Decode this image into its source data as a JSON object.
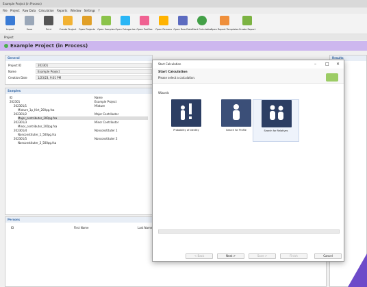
{
  "app": {
    "title": "Example Project (in Process)"
  },
  "menu": [
    "File",
    "Project",
    "Raw Data",
    "Calculation",
    "Reports",
    "Window",
    "Settings",
    "?"
  ],
  "toolbar": [
    {
      "label": "Import",
      "color": "#3a7bd5"
    },
    {
      "label": "Save",
      "color": "#9aa7b8"
    },
    {
      "label": "Print",
      "color": "#555555"
    },
    {
      "label": "Create Project",
      "color": "#f2b233"
    },
    {
      "label": "Open Projects",
      "color": "#e1a028"
    },
    {
      "label": "Open Samples",
      "color": "#8bc34a"
    },
    {
      "label": "Open Categories",
      "color": "#29b6f6"
    },
    {
      "label": "Open Profiles",
      "color": "#f06292"
    },
    {
      "label": "Open Persons",
      "color": "#ffb300"
    },
    {
      "label": "Open Raw Data",
      "color": "#5c6bc0"
    },
    {
      "label": "Start Calculation",
      "color": "#43a047"
    },
    {
      "label": "Open Report Templates",
      "color": "#ef8f3b"
    },
    {
      "label": "Create Report",
      "color": "#7cb342"
    }
  ],
  "tab": "Project",
  "project": {
    "header": "Example Project (in Process)",
    "general": {
      "title": "General",
      "fields": [
        {
          "label": "Project ID",
          "value": "202301"
        },
        {
          "label": "Name",
          "value": "Example Project"
        },
        {
          "label": "Creation Date",
          "value": "1/23/23, 9:01 PM"
        }
      ]
    },
    "samples": {
      "title": "Samples",
      "col_id": "ID",
      "col_name": "Name",
      "rows": [
        {
          "id": "202301",
          "name": "Example Project"
        },
        {
          "id": "202301/1",
          "name": "Mixture"
        },
        {
          "id": "Mixture_1p_Hirt_200pg.fsa",
          "name": ""
        },
        {
          "id": "202301/2",
          "name": "Major Contributor"
        },
        {
          "id": "Major_contributor_200pg.fsa",
          "name": ""
        },
        {
          "id": "202301/3",
          "name": "Minor Contributor"
        },
        {
          "id": "Minor_contributor_200pg.fsa",
          "name": ""
        },
        {
          "id": "202301/4",
          "name": "Nonconstituter 1"
        },
        {
          "id": "Nonconstituter_1_500pg.fsa",
          "name": ""
        },
        {
          "id": "202301/5",
          "name": "Nonconstituter 2"
        },
        {
          "id": "Nonconstituter_2_500pg.fsa",
          "name": ""
        }
      ]
    },
    "persons": {
      "title": "Persons",
      "cols": [
        "ID",
        "First Name",
        "Last Name"
      ]
    },
    "results": {
      "title": "Results"
    }
  },
  "dialog": {
    "title": "Start Calculation",
    "heading": "Start Calculation",
    "subtitle": "Please select a calculation.",
    "section": "Wizards",
    "cards": [
      {
        "label": "Probability of Identity",
        "icon": "identity-icon"
      },
      {
        "label": "Search for Profile",
        "icon": "profile-search-icon"
      },
      {
        "label": "Search for Relatives",
        "icon": "relatives-icon"
      }
    ],
    "buttons": {
      "back": "< Back",
      "next": "Next >",
      "save": "Save >",
      "finish": "Finish",
      "cancel": "Cancel"
    }
  }
}
